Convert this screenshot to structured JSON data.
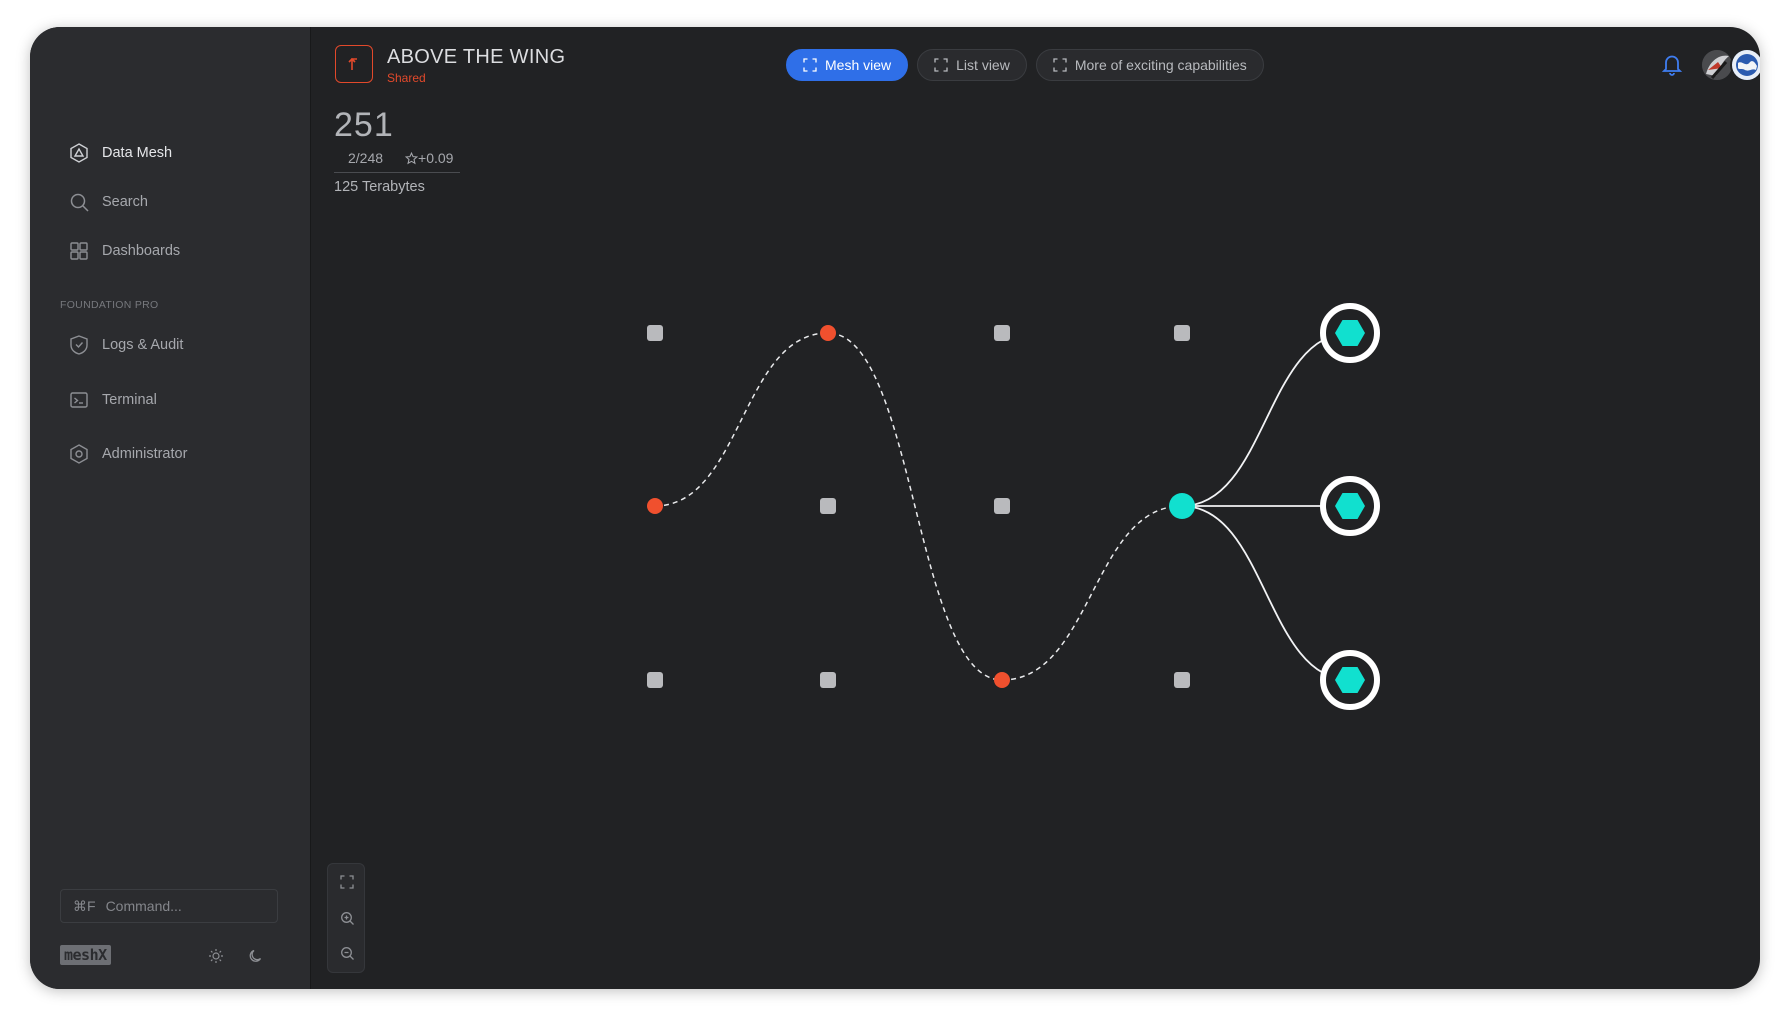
{
  "app": {
    "nav": [
      {
        "label": "Data Mesh",
        "icon": "data-mesh-icon",
        "active": true
      },
      {
        "label": "Search",
        "icon": "search-icon",
        "active": false
      },
      {
        "label": "Dashboards",
        "icon": "dashboard-icon",
        "active": false
      }
    ],
    "section_label": "FOUNDATION PRO",
    "nav_pro": [
      {
        "label": "Logs & Audit",
        "icon": "shield-icon"
      },
      {
        "label": "Terminal",
        "icon": "terminal-icon"
      },
      {
        "label": "Administrator",
        "icon": "settings-icon"
      }
    ],
    "command": {
      "shortcut": "⌘F",
      "placeholder": "Command..."
    },
    "logo_text": "meshX"
  },
  "project": {
    "title": "ABOVE THE WING",
    "status": "Shared",
    "count": "251",
    "ratio": "2/248",
    "delta": "+0.09",
    "size": "125 Terabytes"
  },
  "tabs": [
    {
      "label": "Mesh view",
      "active": true
    },
    {
      "label": "List view",
      "active": false
    },
    {
      "label": "More of exciting capabilities",
      "active": false
    }
  ],
  "colors": {
    "accent": "#2f6fe8",
    "path_node": "#f0502e",
    "destination": "#11e0cf",
    "grid_node": "#b9babd",
    "background": "#212224"
  },
  "mesh": {
    "grid_nodes": [
      [
        0,
        0
      ],
      [
        2,
        0
      ],
      [
        3,
        0
      ],
      [
        1,
        1
      ],
      [
        2,
        1
      ],
      [
        0,
        2
      ],
      [
        1,
        2
      ],
      [
        3,
        2
      ]
    ],
    "path_nodes": [
      [
        1,
        0
      ],
      [
        0,
        1
      ],
      [
        2,
        2
      ]
    ],
    "hub_node": [
      3,
      1
    ],
    "destinations": [
      0,
      1,
      2
    ]
  }
}
